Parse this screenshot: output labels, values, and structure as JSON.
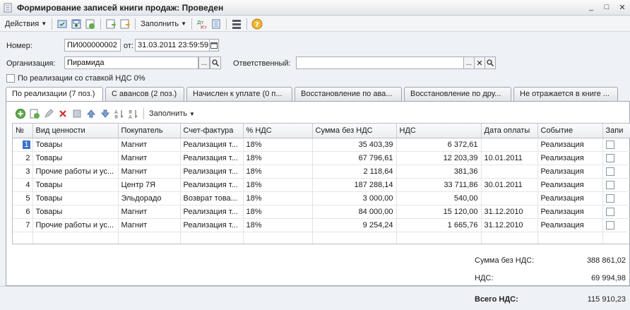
{
  "window": {
    "title": "Формирование записей книги продаж: Проведен"
  },
  "toolbar": {
    "actions_label": "Действия",
    "fill_label": "Заполнить"
  },
  "form": {
    "number_label": "Номер:",
    "number_value": "ПИ000000002",
    "date_label": "от:",
    "date_value": "31.03.2011 23:59:59",
    "org_label": "Организация:",
    "org_value": "Пирамида",
    "responsible_label": "Ответственный:",
    "responsible_value": "",
    "vat0_label": "По реализации со ставкой НДС 0%"
  },
  "tabs": [
    {
      "label": "По реализации (7 поз.)"
    },
    {
      "label": "С авансов (2 поз.)"
    },
    {
      "label": "Начислен к уплате (0 п..."
    },
    {
      "label": "Восстановление по ава..."
    },
    {
      "label": "Восстановление по дру..."
    },
    {
      "label": "Не отражается в книге ..."
    }
  ],
  "inner_toolbar": {
    "fill_label": "Заполнить"
  },
  "table": {
    "columns": [
      "№",
      "Вид ценности",
      "Покупатель",
      "Счет-фактура",
      "% НДС",
      "Сумма без НДС",
      "НДС",
      "Дата оплаты",
      "Событие",
      "Запи"
    ],
    "rows": [
      {
        "n": "1",
        "kind": "Товары",
        "buyer": "Магнит",
        "invoice": "Реализация т...",
        "rate": "18%",
        "sum": "35 403,39",
        "vat": "6 372,61",
        "date": "",
        "event": "Реализация"
      },
      {
        "n": "2",
        "kind": "Товары",
        "buyer": "Магнит",
        "invoice": "Реализация т...",
        "rate": "18%",
        "sum": "67 796,61",
        "vat": "12 203,39",
        "date": "10.01.2011",
        "event": "Реализация"
      },
      {
        "n": "3",
        "kind": "Прочие работы и ус...",
        "buyer": "Магнит",
        "invoice": "Реализация т...",
        "rate": "18%",
        "sum": "2 118,64",
        "vat": "381,36",
        "date": "",
        "event": "Реализация"
      },
      {
        "n": "4",
        "kind": "Товары",
        "buyer": "Центр 7Я",
        "invoice": "Реализация т...",
        "rate": "18%",
        "sum": "187 288,14",
        "vat": "33 711,86",
        "date": "30.01.2011",
        "event": "Реализация"
      },
      {
        "n": "5",
        "kind": "Товары",
        "buyer": "Эльдорадо",
        "invoice": "Возврат това...",
        "rate": "18%",
        "sum": "3 000,00",
        "vat": "540,00",
        "date": "",
        "event": "Реализация"
      },
      {
        "n": "6",
        "kind": "Товары",
        "buyer": "Магнит",
        "invoice": "Реализация т...",
        "rate": "18%",
        "sum": "84 000,00",
        "vat": "15 120,00",
        "date": "31.12.2010",
        "event": "Реализация"
      },
      {
        "n": "7",
        "kind": "Прочие работы и ус...",
        "buyer": "Магнит",
        "invoice": "Реализация т...",
        "rate": "18%",
        "sum": "9 254,24",
        "vat": "1 665,76",
        "date": "31.12.2010",
        "event": "Реализация"
      }
    ]
  },
  "totals": {
    "sum_label": "Сумма без НДС:",
    "sum_value": "388 861,02",
    "vat_label": "НДС:",
    "vat_value": "69 994,98",
    "total_vat_label": "Всего НДС:",
    "total_vat_value": "115 910,23"
  }
}
